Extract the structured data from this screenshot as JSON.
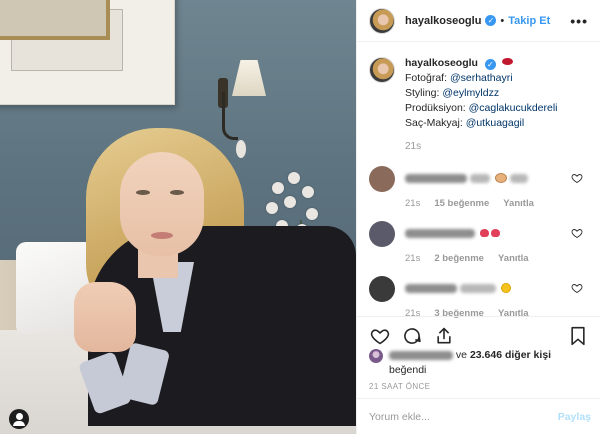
{
  "post": {
    "username": "hayalkoseoglu",
    "follow_label": "Takip Et",
    "dot": "•",
    "caption": {
      "username": "hayalkoseoglu",
      "lines": [
        {
          "label": "Fotoğraf: ",
          "mention": "@serhathayri"
        },
        {
          "label": "Styling: ",
          "mention": "@eylmyldzz"
        },
        {
          "label": "Prodüksiyon: ",
          "mention": "@caglakucukdereli"
        },
        {
          "label": "Saç-Makyaj: ",
          "mention": "@utkuagagil"
        }
      ],
      "time": "21s"
    },
    "comments": [
      {
        "time": "21s",
        "likes": "15 beğenme",
        "reply": "Yanıtla",
        "avatar_color": "#8a6a5a"
      },
      {
        "time": "21s",
        "likes": "2 beğenme",
        "reply": "Yanıtla",
        "avatar_color": "#5a5a6a"
      },
      {
        "time": "21s",
        "likes": "3 beğenme",
        "reply": "Yanıtla",
        "avatar_color": "#3a3a3a"
      }
    ],
    "liked_by": {
      "others": "ve ",
      "count": "23.646 diğer kişi",
      "verb": "beğendi"
    },
    "time_ago": "21 SAAT ÖNCE",
    "add_comment": {
      "placeholder": "Yorum ekle...",
      "post_label": "Paylaş"
    }
  },
  "icons": {
    "more": "more-options-icon",
    "verified": "verified-badge-icon",
    "like": "heart-icon",
    "comment": "comment-icon",
    "share": "share-icon",
    "save": "bookmark-icon",
    "profile": "profile-icon"
  },
  "colors": {
    "accent": "#3897f0",
    "mention": "#003569",
    "muted": "#999999",
    "post_disabled": "#b2dffc"
  }
}
